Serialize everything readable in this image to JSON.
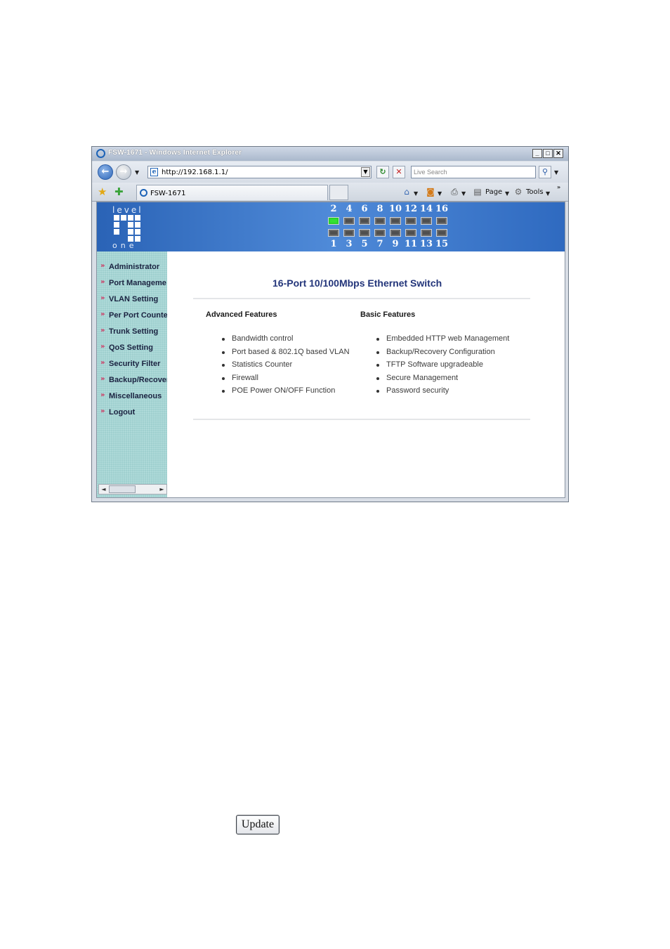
{
  "window": {
    "title": "FSW-1671 - Windows Internet Explorer"
  },
  "address_bar": {
    "url": "http://192.168.1.1/"
  },
  "search": {
    "placeholder": "Live Search"
  },
  "tab": {
    "label": "FSW-1671"
  },
  "command_bar": {
    "page_label": "Page",
    "tools_label": "Tools"
  },
  "banner": {
    "logo_top": "level",
    "logo_bottom": "one",
    "ports_top": [
      "2",
      "4",
      "6",
      "8",
      "10",
      "12",
      "14",
      "16"
    ],
    "ports_bottom": [
      "1",
      "3",
      "5",
      "7",
      "9",
      "11",
      "13",
      "15"
    ],
    "active_ports": [
      "2"
    ],
    "colors": {
      "banner": "#2a63b6",
      "port_active": "#2bd12b",
      "port_inactive": "#6b6b6b"
    }
  },
  "sidebar": {
    "items": [
      {
        "label": "Administrator"
      },
      {
        "label": "Port Manageme"
      },
      {
        "label": "VLAN Setting"
      },
      {
        "label": "Per Port Counte"
      },
      {
        "label": "Trunk Setting"
      },
      {
        "label": "QoS Setting"
      },
      {
        "label": "Security Filter"
      },
      {
        "label": "Backup/Recover"
      },
      {
        "label": "Miscellaneous"
      },
      {
        "label": "Logout"
      }
    ]
  },
  "main": {
    "title": "16-Port 10/100Mbps Ethernet Switch",
    "advanced": {
      "heading": "Advanced Features",
      "items": [
        "Bandwidth control",
        "Port based & 802.1Q based VLAN",
        "Statistics Counter",
        "Firewall",
        "POE Power ON/OFF Function"
      ]
    },
    "basic": {
      "heading": "Basic Features",
      "items": [
        "Embedded HTTP web Management",
        "Backup/Recovery Configuration",
        "TFTP Software upgradeable",
        "Secure Management",
        "Password security"
      ]
    }
  },
  "update_button": {
    "label": "Update"
  }
}
